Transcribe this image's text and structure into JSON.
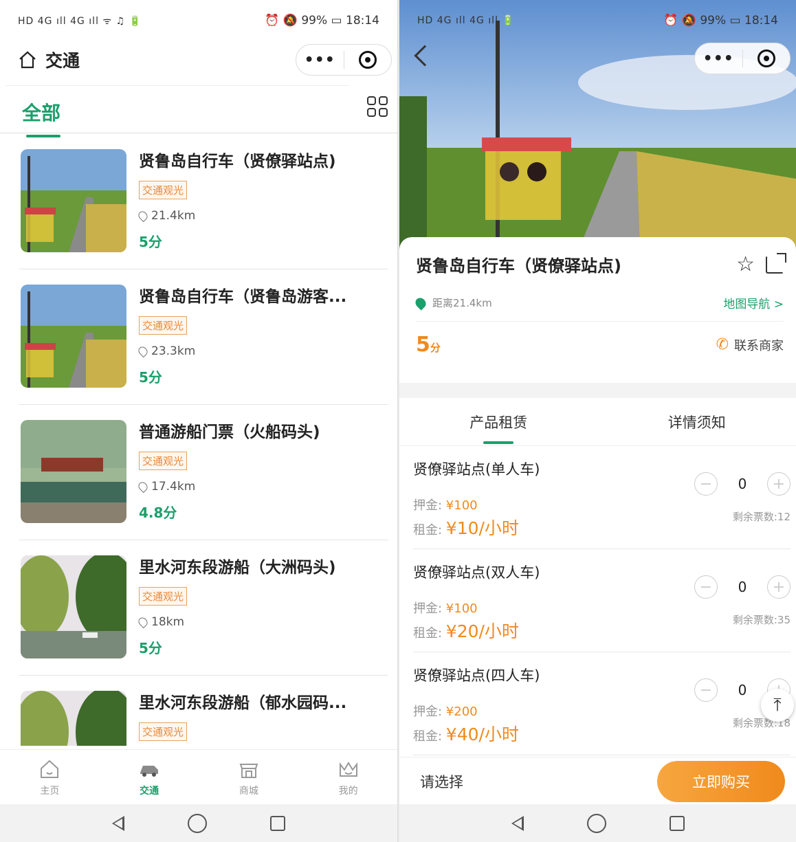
{
  "left": {
    "status_left": "HD 4G ıll 4G ıll ᯤ ♫ 🔋",
    "status_right": "⏰ 🔕 99% ▭ 18:14",
    "title": "交通",
    "capsule_dots": "•••",
    "category_all": "全部",
    "items": [
      {
        "name": "贤鲁岛自行车（贤僚驿站点)",
        "tag": "交通观光",
        "dist": "21.4km",
        "score": "5分"
      },
      {
        "name": "贤鲁岛自行车（贤鲁岛游客...",
        "tag": "交通观光",
        "dist": "23.3km",
        "score": "5分"
      },
      {
        "name": "普通游船门票（火船码头)",
        "tag": "交通观光",
        "dist": "17.4km",
        "score": "4.8分"
      },
      {
        "name": "里水河东段游船（大洲码头)",
        "tag": "交通观光",
        "dist": "18km",
        "score": "5分"
      },
      {
        "name": "里水河东段游船（郁水园码...",
        "tag": "交通观光",
        "dist": "",
        "score": ""
      }
    ],
    "tabs": [
      "主页",
      "交通",
      "商城",
      "我的"
    ]
  },
  "right": {
    "status_left": "HD 4G ıll 4G ıll 🔋",
    "status_right": "⏰ 🔕 99% ▭ 18:14",
    "capsule_dots": "•••",
    "product_name": "贤鲁岛自行车（贤僚驿站点)",
    "distance": "距离21.4km",
    "map_nav": "地图导航 >",
    "score_value": "5",
    "score_unit": "分",
    "contact": "联系商家",
    "tabs": [
      "产品租赁",
      "详情须知"
    ],
    "products": [
      {
        "name": "贤僚驿站点(单人车)",
        "deposit_label": "押金: ",
        "deposit": "¥100",
        "rent_label": "租金: ",
        "rent": "¥10/小时",
        "qty": "0",
        "remain": "剩余票数:12"
      },
      {
        "name": "贤僚驿站点(双人车)",
        "deposit_label": "押金: ",
        "deposit": "¥100",
        "rent_label": "租金: ",
        "rent": "¥20/小时",
        "qty": "0",
        "remain": "剩余票数:35"
      },
      {
        "name": "贤僚驿站点(四人车)",
        "deposit_label": "押金: ",
        "deposit": "¥200",
        "rent_label": "租金: ",
        "rent": "¥40/小时",
        "qty": "0",
        "remain": "剩余票数:18"
      }
    ],
    "choose": "请选择",
    "buy": "立即购买",
    "to_top": "⤒"
  },
  "colors": {
    "accent_green": "#1aa06b",
    "accent_orange": "#f08a1c"
  }
}
